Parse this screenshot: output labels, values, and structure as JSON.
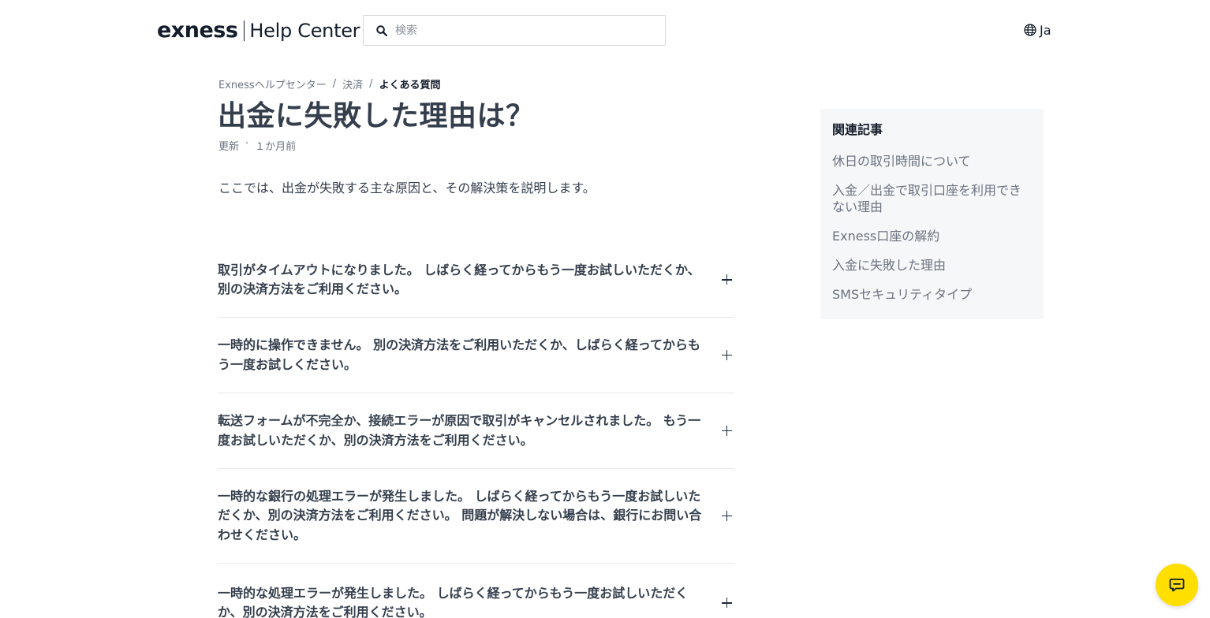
{
  "header": {
    "logo_brand": "exness",
    "logo_suffix": "Help Center",
    "search_placeholder": "検索",
    "language": "Ja"
  },
  "breadcrumb": [
    {
      "label": "Exnessヘルプセンター"
    },
    {
      "label": "決済"
    },
    {
      "label": "よくある質問"
    }
  ],
  "breadcrumb_separator": "/",
  "article": {
    "title": "出金に失敗した理由は？",
    "meta_updated": "更新",
    "meta_dot": "·",
    "meta_time": "１か月前",
    "intro": "ここでは、出金が失敗する主な原因と、その解決策を説明します。"
  },
  "faq": [
    {
      "question": "取引がタイムアウトになりました。 しばらく経ってからもう一度お試しいただくか、別の決済方法をご利用ください。"
    },
    {
      "question": "一時的に操作できません。 別の決済方法をご利用いただくか、しばらく経ってからもう一度お試しください。"
    },
    {
      "question": "転送フォームが不完全か、接続エラーが原因で取引がキャンセルされました。 もう一度お試しいただくか、別の決済方法をご利用ください。"
    },
    {
      "question": "一時的な銀行の処理エラーが発生しました。 しばらく経ってからもう一度お試しいただくか、別の決済方法をご利用ください。 問題が解決しない場合は、銀行にお問い合わせください。"
    },
    {
      "question": "一時的な処理エラーが発生しました。 しばらく経ってからもう一度お試しいただくか、別の決済方法をご利用ください。"
    }
  ],
  "related": {
    "heading": "関連記事",
    "items": [
      {
        "label": "休日の取引時間について"
      },
      {
        "label": "入金／出金で取引口座を利用できない理由"
      },
      {
        "label": "Exness口座の解約"
      },
      {
        "label": "入金に失敗した理由"
      },
      {
        "label": "SMSセキュリティタイプ"
      }
    ]
  },
  "colors": {
    "accent_chat": "#ffde02",
    "text_dark": "#343e4c",
    "text_muted": "#6b7380",
    "sidebar_bg": "#f6f7f8"
  },
  "icons": {
    "search": "search-icon",
    "language": "globe-icon",
    "expand": "plus-icon",
    "chat": "chat-icon"
  }
}
